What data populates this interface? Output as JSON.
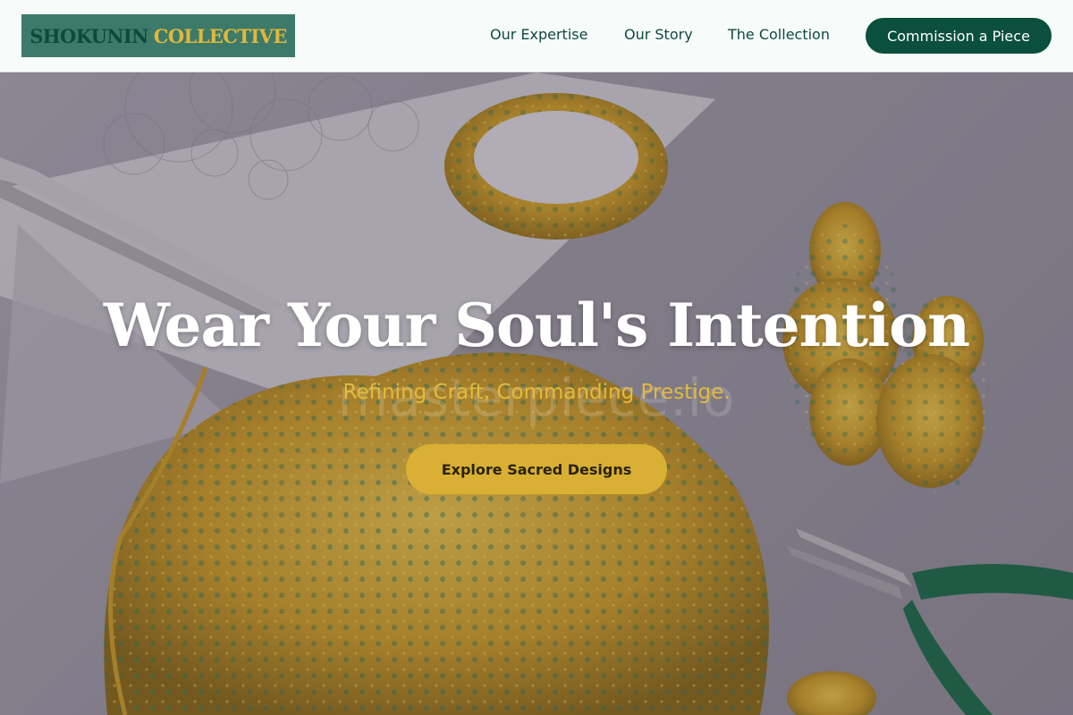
{
  "header": {
    "logo_word1": "SHOKUNIN",
    "logo_word2": "COLLECTIVE",
    "nav": [
      "Our Expertise",
      "Our Story",
      "The Collection"
    ],
    "cta": "Commission a Piece"
  },
  "hero": {
    "headline": "Wear Your Soul's Intention",
    "watermark": "masterpiece.io",
    "tagline": "Refining Craft, Commanding Prestige.",
    "cta": "Explore Sacred Designs",
    "image_subject": "gold jewelry with tools on sketch paper"
  },
  "colors": {
    "brand_green": "#0b4f3e",
    "logo_bg": "#3d7a6a",
    "gold": "#d9b033",
    "tagline_gold": "#e3bb3c"
  }
}
